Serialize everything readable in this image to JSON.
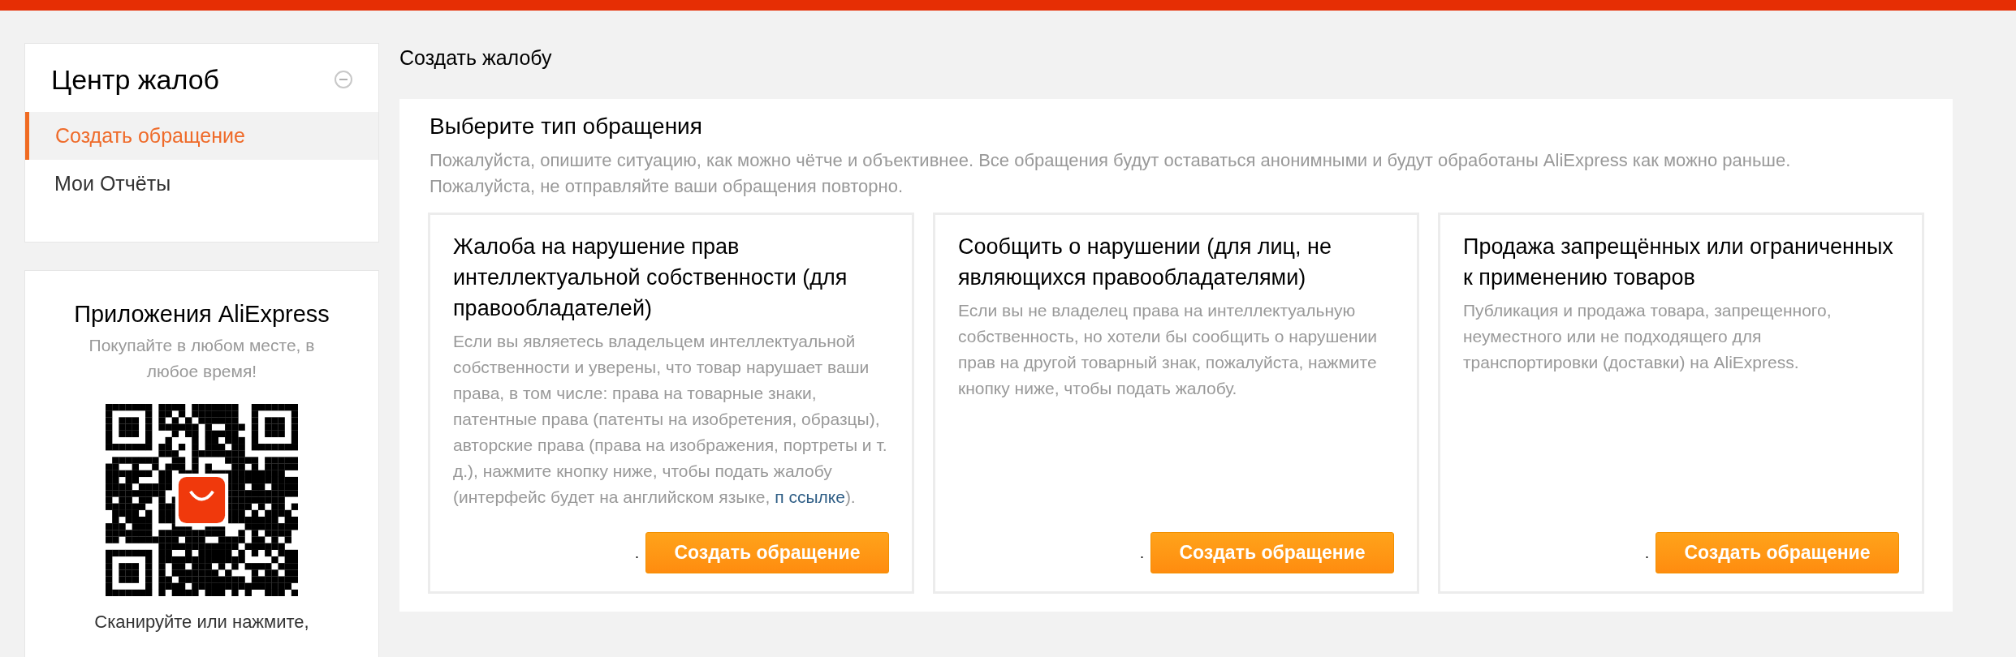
{
  "sidebar": {
    "title": "Центр жалоб",
    "items": [
      {
        "label": "Создать обращение",
        "selected": true
      },
      {
        "label": "Мои Отчёты",
        "selected": false
      }
    ]
  },
  "app_promo": {
    "title": "Приложения AliExpress",
    "subtitle": "Покупайте в любом месте, в любое время!",
    "caption": "Сканируйте или нажмите,"
  },
  "page_title": "Создать жалобу",
  "panel": {
    "heading": "Выберите тип обращения",
    "intro": "Пожалуйста, опишите ситуацию, как можно чётче и объективнее. Все обращения будут оставаться анонимными и будут обработаны AliExpress как можно раньше. Пожалуйста, не отправляйте ваши обращения повторно.",
    "cards": [
      {
        "title": "Жалоба на нарушение прав интеллектуальной собственности (для правообладателей)",
        "description": "Если вы являетесь владельцем интеллектуальной собственности и уверены, что товар нарушает ваши права, в том числе: права на товарные знаки, патентные права (патенты на изобретения, образцы), авторские права (права на изображения, портреты и т. д.), нажмите кнопку ниже, чтобы подать жалобу (интерфейс будет на английском языке,",
        "link_start": "п",
        "link_end": "ссылке",
        "after_link": ").",
        "dot": ".",
        "button": "Создать обращение"
      },
      {
        "title": "Сообщить о нарушении (для лиц, не являющихся правообладателями)",
        "description": "Если вы не владелец права на интеллектуальную собственность, но хотели бы сообщить о нарушении прав на другой товарный знак, пожалуйста, нажмите кнопку ниже, чтобы подать жалобу.",
        "dot": ".",
        "button": "Создать обращение"
      },
      {
        "title": "Продажа запрещённых или ограниченных к применению товаров",
        "description": "Публикация и продажа товара, запрещенного, неуместного или не подходящего для транспортировки (доставки) на AliExpress.",
        "dot": ".",
        "button": "Создать обращение"
      }
    ]
  }
}
